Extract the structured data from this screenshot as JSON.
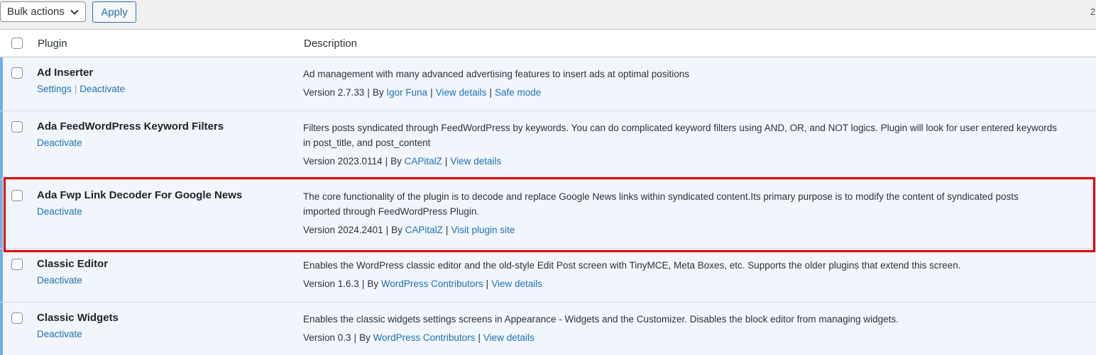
{
  "toolbar": {
    "bulk_actions_label": "Bulk actions",
    "apply_label": "Apply",
    "item_count": "2"
  },
  "table": {
    "headers": {
      "plugin": "Plugin",
      "description": "Description"
    }
  },
  "plugins": [
    {
      "name": "Ad Inserter",
      "actions": [
        "Settings",
        "Deactivate"
      ],
      "description": [
        "Ad management with many advanced advertising features to insert ads at optimal positions"
      ],
      "version": "Version 2.7.33",
      "by": "By",
      "author": "Igor Funa",
      "links": [
        "View details",
        "Safe mode"
      ]
    },
    {
      "name": "Ada FeedWordPress Keyword Filters",
      "actions": [
        "Deactivate"
      ],
      "description": [
        "Filters posts syndicated through FeedWordPress by keywords. You can do complicated keyword filters using AND, OR, and NOT logics. Plugin will look for user entered keywords",
        "in post_title, and post_content"
      ],
      "version": "Version 2023.0114",
      "by": "By",
      "author": "CAPitalZ",
      "links": [
        "View details"
      ]
    },
    {
      "name": "Ada Fwp Link Decoder For Google News",
      "actions": [
        "Deactivate"
      ],
      "description": [
        "The core functionality of the plugin is to decode and replace Google News links within syndicated content.Its primary purpose is to modify the content of syndicated posts",
        "imported through FeedWordPress Plugin."
      ],
      "version": "Version 2024.2401",
      "by": "By",
      "author": "CAPitalZ",
      "links": [
        "Visit plugin site"
      ]
    },
    {
      "name": "Classic Editor",
      "actions": [
        "Deactivate"
      ],
      "description": [
        "Enables the WordPress classic editor and the old-style Edit Post screen with TinyMCE, Meta Boxes, etc. Supports the older plugins that extend this screen."
      ],
      "version": "Version 1.6.3",
      "by": "By",
      "author": "WordPress Contributors",
      "links": [
        "View details"
      ]
    },
    {
      "name": "Classic Widgets",
      "actions": [
        "Deactivate"
      ],
      "description": [
        "Enables the classic widgets settings screens in Appearance - Widgets and the Customizer. Disables the block editor from managing widgets."
      ],
      "version": "Version 0.3",
      "by": "By",
      "author": "WordPress Contributors",
      "links": [
        "View details"
      ]
    }
  ],
  "colors": {
    "link": "#2271b1",
    "active_row_bg": "#f0f6fc",
    "active_row_border": "#72aee6",
    "highlight": "#e00000"
  }
}
